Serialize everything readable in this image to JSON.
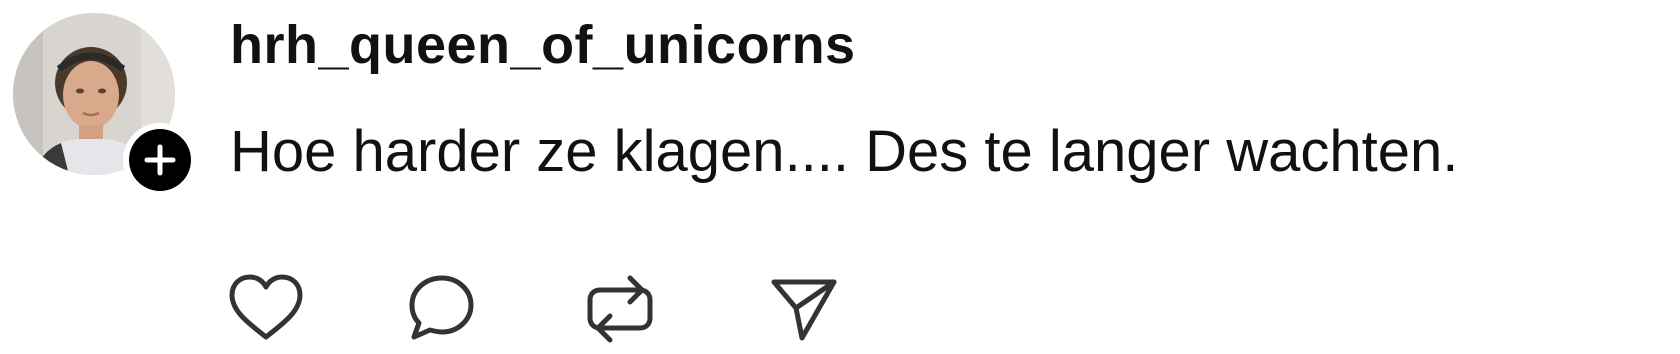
{
  "post": {
    "username": "hrh_queen_of_unicorns",
    "text": "Hoe harder ze klagen.... Des te langer wachten.",
    "avatar_icon": "profile-photo",
    "follow_icon": "plus-icon"
  },
  "actions": [
    {
      "name": "like",
      "icon": "heart-icon"
    },
    {
      "name": "reply",
      "icon": "comment-icon"
    },
    {
      "name": "repost",
      "icon": "repost-icon"
    },
    {
      "name": "share",
      "icon": "send-icon"
    }
  ],
  "colors": {
    "text": "#111111",
    "background": "#ffffff",
    "follow_badge": "#000000",
    "icon_stroke": "#333333"
  }
}
